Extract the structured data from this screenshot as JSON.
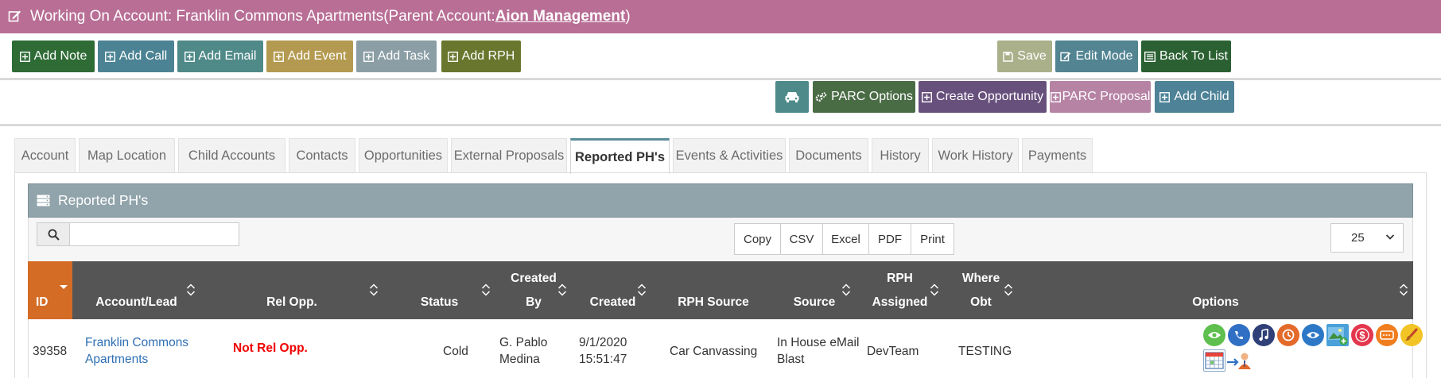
{
  "titlebar": {
    "prefix": "Working On Account: Franklin Commons Apartments(Parent Account: ",
    "parent_link": "Aion Management",
    "suffix": ")"
  },
  "actions": {
    "add_note": "Add Note",
    "add_call": "Add Call",
    "add_email": "Add Email",
    "add_event": "Add Event",
    "add_task": "Add Task",
    "add_rph": "Add RPH",
    "save": "Save",
    "edit_mode": "Edit Mode",
    "back_to_list": "Back To List"
  },
  "actions2": {
    "parc_options": "PARC Options",
    "create_opportunity": "Create Opportunity",
    "parc_proposal": "PARC Proposal",
    "add_child": "Add Child"
  },
  "tabs": [
    "Account",
    "Map Location",
    "Child Accounts",
    "Contacts",
    "Opportunities",
    "External Proposals",
    "Reported PH's",
    "Events & Activities",
    "Documents",
    "History",
    "Work History",
    "Payments"
  ],
  "active_tab": "Reported PH's",
  "panel": {
    "title": "Reported PH's"
  },
  "search": {
    "value": "",
    "placeholder": ""
  },
  "export": [
    "Copy",
    "CSV",
    "Excel",
    "PDF",
    "Print"
  ],
  "page_size": "25",
  "columns": {
    "id": "ID",
    "account": "Account/Lead",
    "rel_opp": "Rel Opp.",
    "status": "Status",
    "created_by_1": "Created",
    "created_by_2": "By",
    "created": "Created",
    "rph_source": "RPH Source",
    "source": "Source",
    "rph_assigned_1": "RPH",
    "rph_assigned_2": "Assigned",
    "where_obt_1": "Where",
    "where_obt_2": "Obt",
    "options": "Options"
  },
  "rows": [
    {
      "id": "39358",
      "account_1": "Franklin Commons",
      "account_2": "Apartments",
      "rel_opp": "Not Rel Opp.",
      "status": "Cold",
      "created_by_1": "G. Pablo",
      "created_by_2": "Medina",
      "created_1": "9/1/2020",
      "created_2": "15:51:47",
      "rph_source": "Car Canvassing",
      "source_1": "In House eMail",
      "source_2": "Blast",
      "rph_assigned": "DevTeam",
      "where_obt": "TESTING"
    }
  ],
  "option_icons": [
    "view-icon",
    "telephone-icon",
    "music-icon",
    "history-icon",
    "eye-icon",
    "add-image-icon",
    "dollar-icon",
    "ticket-icon",
    "brush-icon",
    "calendar-icon",
    "assign-user-icon"
  ],
  "colors": {
    "titlebar": "#b86e95",
    "add_note": "#2e6b35",
    "add_call": "#4c8394",
    "add_email": "#4f8a88",
    "add_event": "#b49a50",
    "add_task": "#8b9ea5",
    "add_rph": "#69762e",
    "save": "#a9b08a",
    "edit_mode": "#528492",
    "back_to_list": "#2b6132",
    "car_button": "#4e8a8a",
    "parc_options": "#4a6c45",
    "create_opportunity": "#68507d",
    "parc_proposal": "#b683a5",
    "add_child": "#4d8297",
    "table_header": "#555555",
    "id_header": "#d46c25",
    "panel_header": "#91a4ab",
    "link": "#2f6fb3",
    "not_rel": "#f00000"
  }
}
